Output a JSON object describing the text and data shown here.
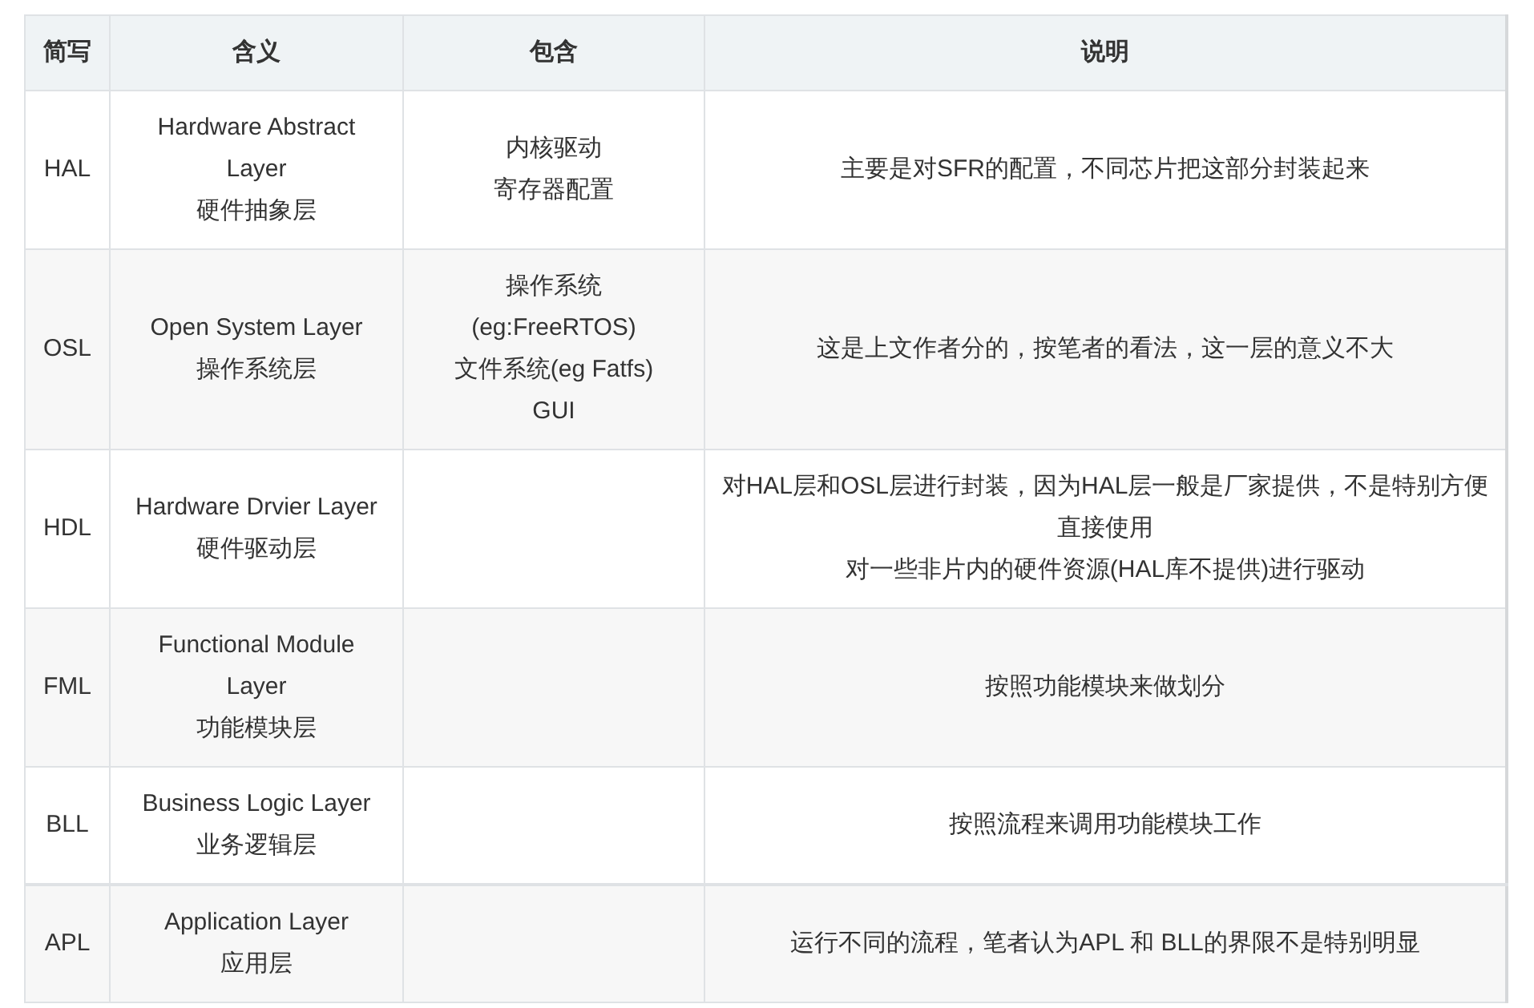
{
  "table": {
    "columns": [
      "简写",
      "含义",
      "包含",
      "说明"
    ],
    "rows": [
      {
        "abbr": "HAL",
        "meaning": [
          "Hardware Abstract Layer",
          "硬件抽象层"
        ],
        "contains": [
          "内核驱动",
          "寄存器配置"
        ],
        "description": [
          "主要是对SFR的配置，不同芯片把这部分封装起来"
        ]
      },
      {
        "abbr": "OSL",
        "meaning": [
          "Open System Layer",
          "操作系统层"
        ],
        "contains": [
          "操作系统",
          "(eg:FreeRTOS)",
          "文件系统(eg Fatfs)",
          "GUI"
        ],
        "description": [
          "这是上文作者分的，按笔者的看法，这一层的意义不大"
        ]
      },
      {
        "abbr": "HDL",
        "meaning": [
          "Hardware Drvier Layer",
          "硬件驱动层"
        ],
        "description": [
          "对HAL层和OSL层进行封装，因为HAL层一般是厂家提供，不是特别方便直接使用",
          "对一些非片内的硬件资源(HAL库不提供)进行驱动"
        ]
      },
      {
        "abbr": "FML",
        "meaning": [
          "Functional Module Layer",
          "功能模块层"
        ],
        "description": [
          "按照功能模块来做划分"
        ]
      },
      {
        "abbr": "BLL",
        "meaning": [
          "Business Logic Layer",
          "业务逻辑层"
        ],
        "description": [
          "按照流程来调用功能模块工作"
        ]
      },
      {
        "abbr": "APL",
        "meaning": [
          "Application Layer",
          "应用层"
        ],
        "description": [
          "运行不同的流程，笔者认为APL 和 BLL的界限不是特别明显"
        ]
      }
    ]
  }
}
